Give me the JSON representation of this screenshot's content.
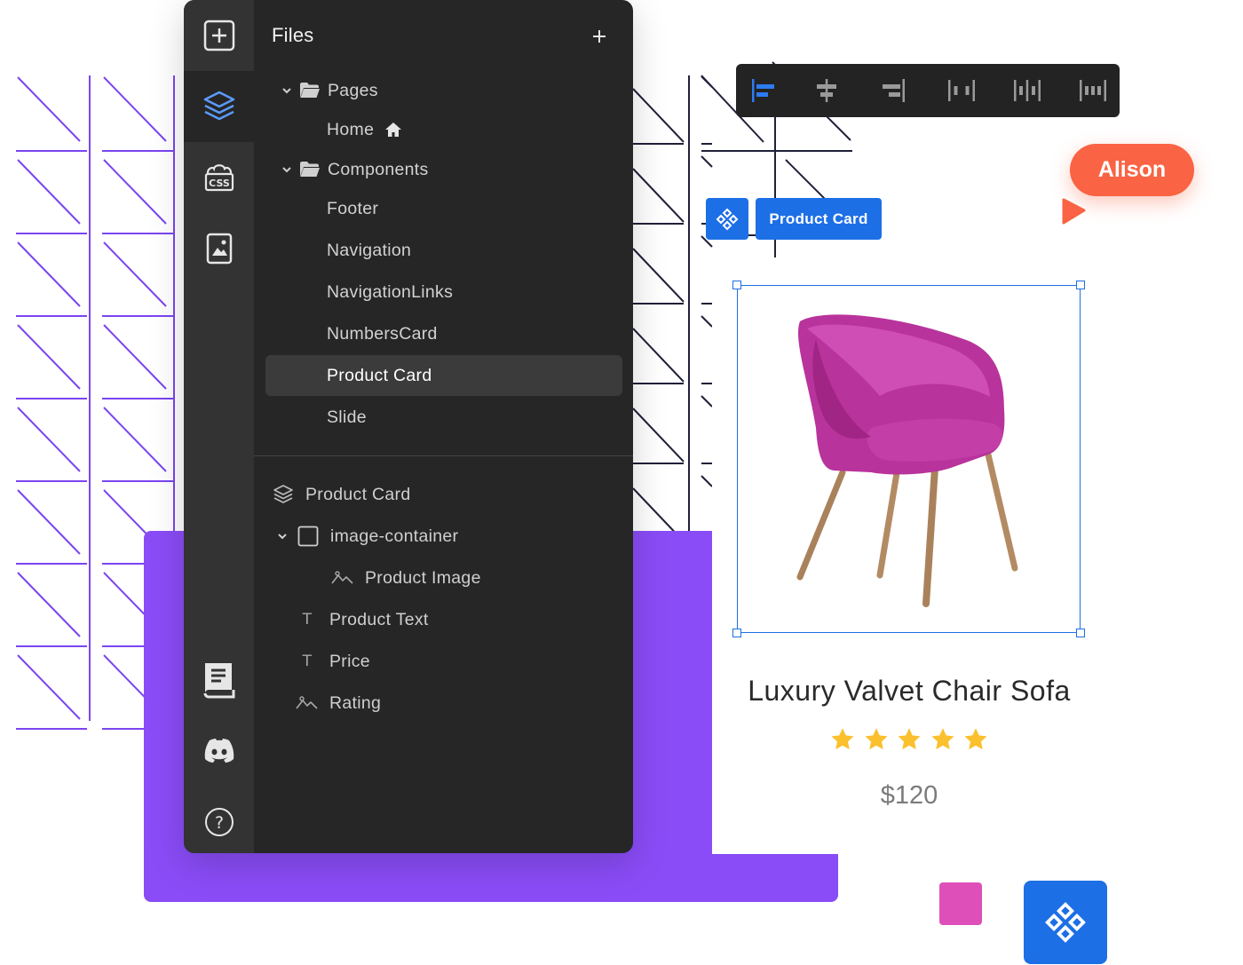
{
  "files_panel": {
    "title": "Files",
    "tree": [
      {
        "label": "Pages",
        "kind": "folder",
        "expanded": true
      },
      {
        "label": "Home",
        "kind": "page",
        "home": true
      },
      {
        "label": "Components",
        "kind": "folder",
        "expanded": true
      },
      {
        "label": "Footer",
        "kind": "component"
      },
      {
        "label": "Navigation",
        "kind": "component"
      },
      {
        "label": "NavigationLinks",
        "kind": "component"
      },
      {
        "label": "NumbersCard",
        "kind": "component"
      },
      {
        "label": "Product Card",
        "kind": "component",
        "selected": true
      },
      {
        "label": "Slide",
        "kind": "component"
      }
    ]
  },
  "layers_panel": {
    "root": "Product Card",
    "items": [
      {
        "label": "image-container",
        "kind": "container",
        "expanded": true
      },
      {
        "label": "Product Image",
        "kind": "image"
      },
      {
        "label": "Product Text",
        "kind": "text"
      },
      {
        "label": "Price",
        "kind": "text"
      },
      {
        "label": "Rating",
        "kind": "image"
      }
    ]
  },
  "rail": {
    "items": [
      "add-icon",
      "layers-icon",
      "css-icon",
      "image-assets-icon",
      "docs-book-icon",
      "discord-icon",
      "help-icon"
    ],
    "active": "layers-icon"
  },
  "toolbar": {
    "tools": [
      "align-left-icon",
      "align-center-icon",
      "align-right-icon",
      "distribute-icon",
      "distribute-even-icon",
      "distribute-around-icon"
    ],
    "active": "align-left-icon"
  },
  "canvas": {
    "component_label": "Product Card",
    "collaborator": "Alison",
    "product": {
      "title": "Luxury Valvet Chair Sofa",
      "rating": 5,
      "price": "$120"
    }
  },
  "colors": {
    "accent_blue": "#1d6fe6",
    "purple": "#8a4cf7",
    "collaborator_orange": "#fa6343",
    "star_yellow": "#fbc02d",
    "swatch_pink": "#de4fb9",
    "chair_magenta": "#b8339b"
  }
}
